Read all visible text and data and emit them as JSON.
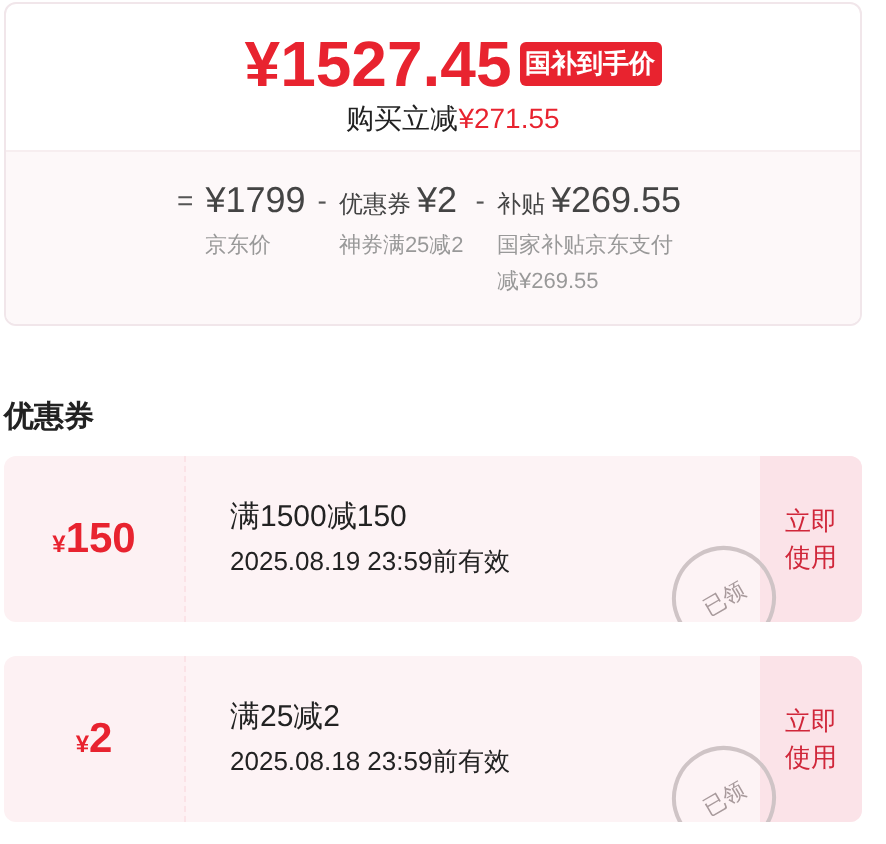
{
  "price": {
    "value": "¥1527.45",
    "badge": "国补到手价",
    "savings_label": "购买立减",
    "savings_value": "¥271.55"
  },
  "breakdown": [
    {
      "operator": "=",
      "value": "¥1799",
      "note": "京东价"
    },
    {
      "operator": "-",
      "label": "优惠券",
      "value": "¥2",
      "note": "神券满25减2"
    },
    {
      "operator": "-",
      "label": "补贴",
      "value": "¥269.55",
      "note": "国家补贴京东支付减¥269.55"
    }
  ],
  "coupons_title": "优惠券",
  "coupons": [
    {
      "currency": "¥",
      "amount": "150",
      "condition": "满1500减150",
      "expiry": "2025.08.19 23:59前有效",
      "stamp": "已领",
      "action": "立即使用"
    },
    {
      "currency": "¥",
      "amount": "2",
      "condition": "满25减2",
      "expiry": "2025.08.18 23:59前有效",
      "stamp": "已领",
      "action": "立即使用"
    }
  ]
}
